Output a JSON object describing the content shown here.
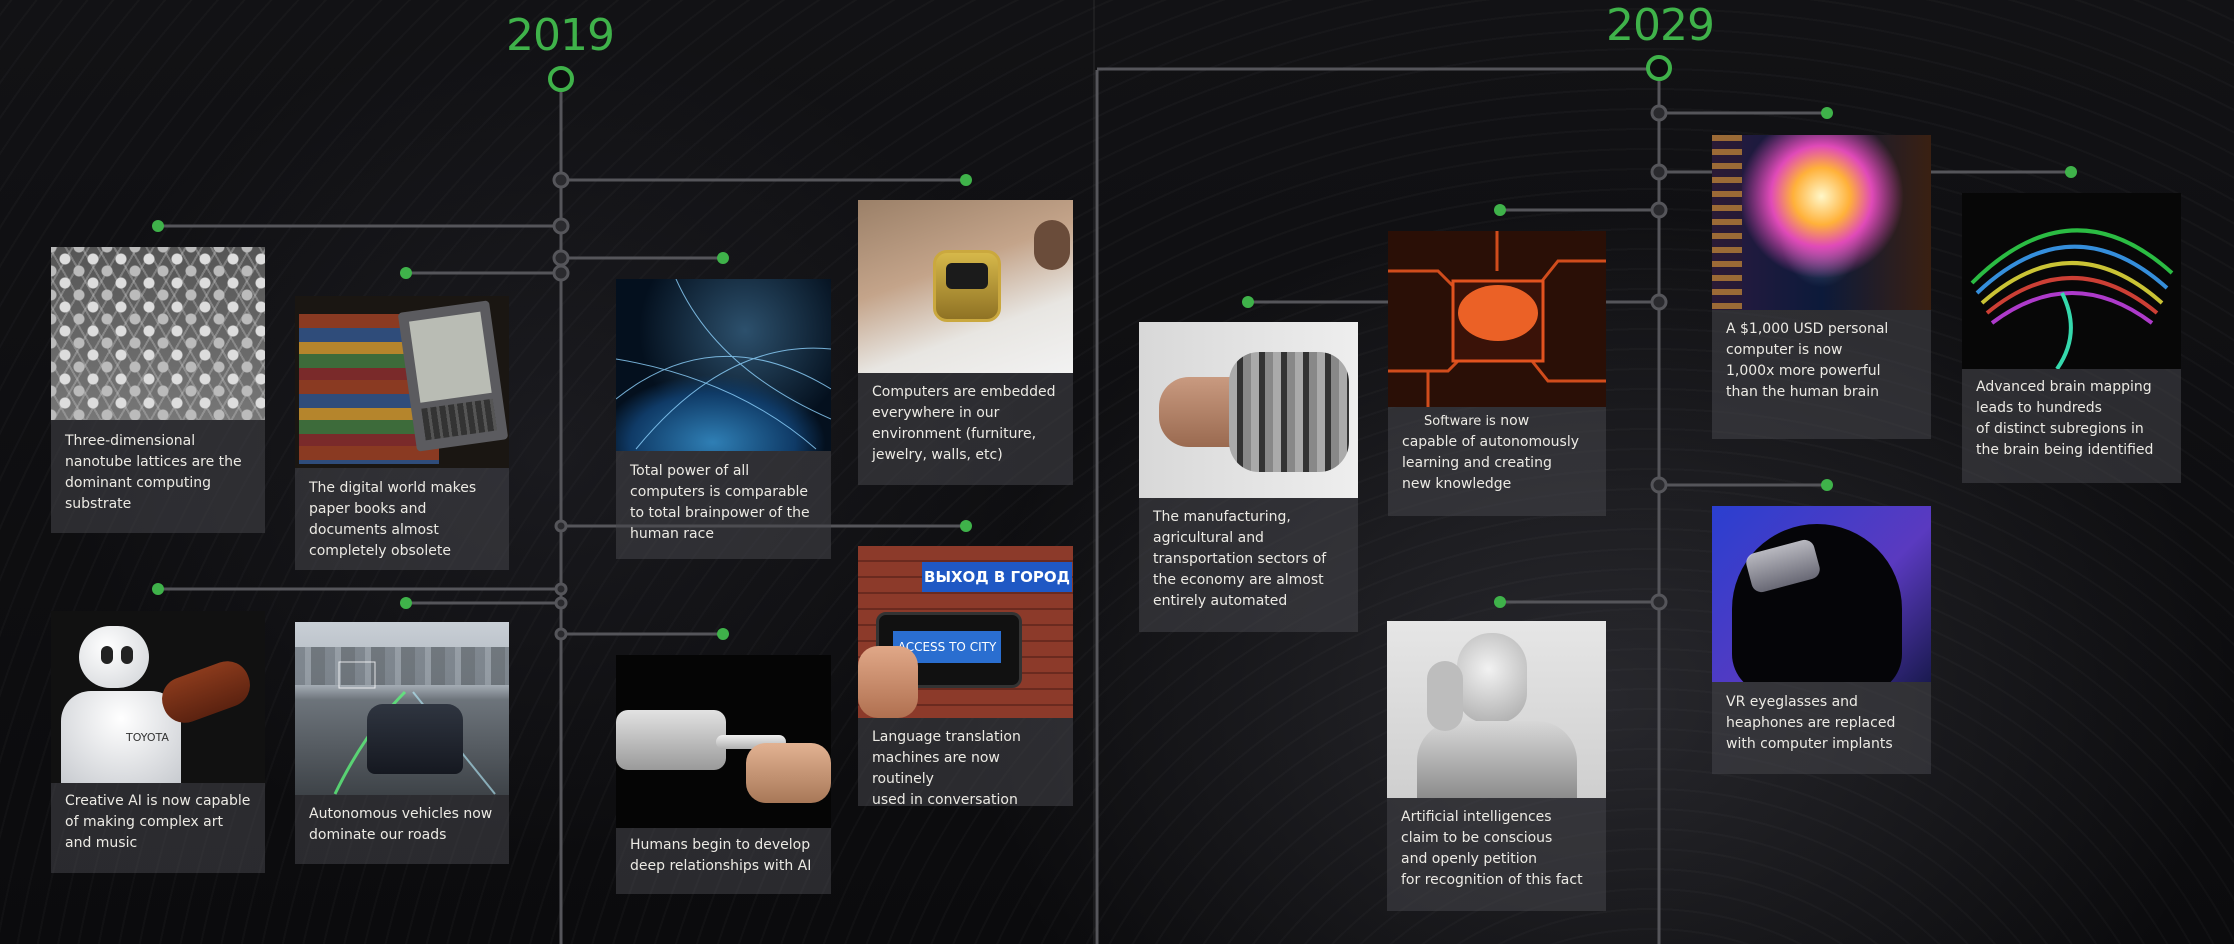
{
  "timeline": {
    "year_left": "2019",
    "year_right": "2029"
  },
  "cards_2019": [
    {
      "id": "graphene",
      "caption": [
        "Three-dimensional",
        "nanotube lattices are the",
        "dominant computing",
        "substrate"
      ],
      "image": "graphene-lattice"
    },
    {
      "id": "books",
      "caption": [
        "The digital world makes",
        "paper books and",
        "documents almost",
        "completely obsolete"
      ],
      "image": "books-and-ereader"
    },
    {
      "id": "earth",
      "caption": [
        "Total power of all",
        "computers is comparable",
        "to total brainpower of the",
        "human race"
      ],
      "image": "networked-earth"
    },
    {
      "id": "watch",
      "caption": [
        "Computers are embedded",
        "everywhere in our",
        "environment (furniture,",
        "jewelry, walls, etc)"
      ],
      "image": "smartwatch"
    },
    {
      "id": "robot-violin",
      "caption": [
        "Creative AI is now capable",
        "of making complex art",
        "and music"
      ],
      "image": "robot-violinist",
      "image_text": "TOYOTA"
    },
    {
      "id": "car",
      "caption": [
        "Autonomous vehicles now",
        "dominate our roads"
      ],
      "image": "autonomous-car"
    },
    {
      "id": "touch",
      "caption": [
        "Humans begin to develop",
        "deep relationships with AI"
      ],
      "image": "robot-human-touch"
    },
    {
      "id": "translate",
      "caption": [
        "Language translation",
        "machines are now routinely",
        "used in conversation"
      ],
      "image": "phone-translation",
      "sign_text": "ВЫХОД В ГОРОД",
      "phone_text": "ACCESS TO CITY"
    }
  ],
  "cards_2029": [
    {
      "id": "handshake",
      "caption": [
        "The manufacturing,",
        "agricultural and",
        "transportation sectors of",
        "the economy are almost",
        "entirely automated"
      ],
      "image": "robot-handshake"
    },
    {
      "id": "chip",
      "caption_first": "Software is",
      "caption_first_b": "now",
      "caption": [
        "capable of autonomously",
        "learning and creating",
        "new knowledge"
      ],
      "image": "brain-chip"
    },
    {
      "id": "head",
      "caption": [
        "A $1,000 USD personal",
        "computer is now",
        "1,000x more powerful",
        "than the human brain"
      ],
      "image": "digital-head"
    },
    {
      "id": "brainmap",
      "caption": [
        "Advanced brain mapping",
        "leads to hundreds",
        "of distinct subregions in",
        "the brain being identified"
      ],
      "image": "brain-tractography"
    },
    {
      "id": "android",
      "caption": [
        "Artificial intelligences",
        "claim to be conscious",
        "and openly petition",
        "for recognition of this fact"
      ],
      "image": "thinking-android"
    },
    {
      "id": "implant",
      "caption": [
        "VR eyeglasses and",
        "heaphones are replaced",
        "with computer implants"
      ],
      "image": "head-implant-silhouette"
    }
  ],
  "colors": {
    "accent_green": "#3fb24a",
    "line": "#5a5a5e",
    "card_bg": "#46464a"
  }
}
